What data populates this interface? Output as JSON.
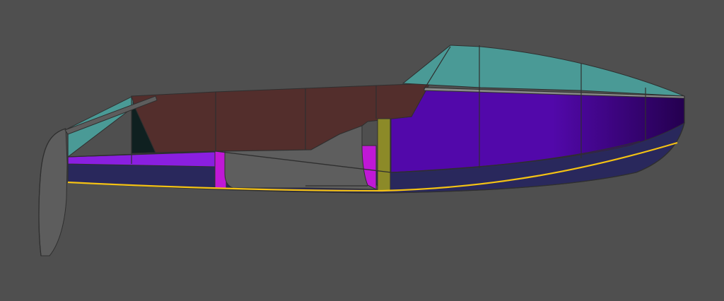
{
  "diagram": {
    "background": "#4f4f4f",
    "colors": {
      "glass": "#4a9a96",
      "deck": "#532e2c",
      "topsides": "#5208aa",
      "topsides_bow": "#24004f",
      "bottom": "#29285c",
      "interior_magenta": "#c018d6",
      "interior_violet": "#8a1fe0",
      "bulkhead": "#8c8a28",
      "cabin_grey": "#5e5e5e",
      "rudder": "#5d5d5d",
      "transom_dark": "#0f2020",
      "waterline": "#f4c214",
      "outline": "#2f2f2f",
      "sheer_light": "#8a8a8a"
    },
    "parts": [
      "rudder",
      "hull-bottom",
      "topsides",
      "cockpit-glass",
      "deck",
      "cabin-top-glass",
      "interior",
      "bulkhead",
      "tiller",
      "waterline"
    ]
  }
}
